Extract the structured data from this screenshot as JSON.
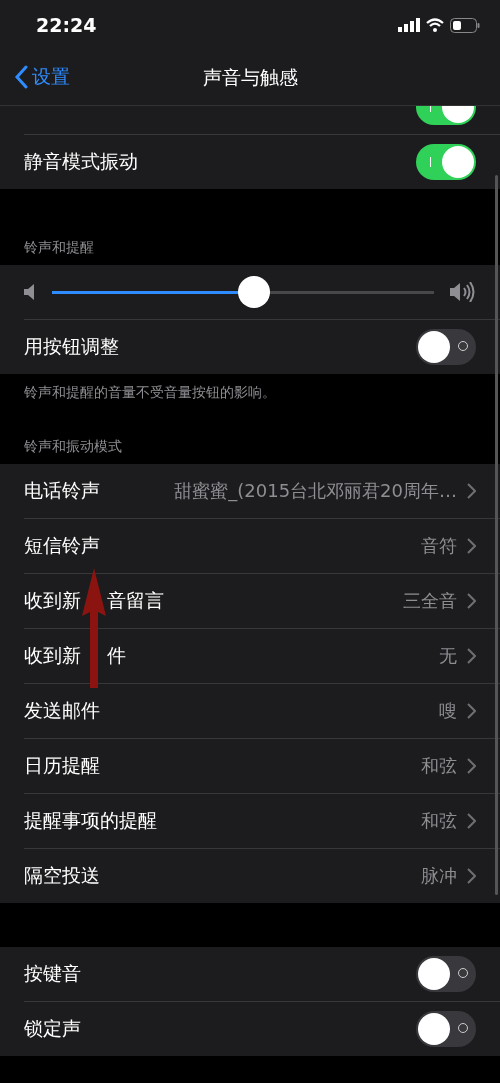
{
  "status_bar": {
    "time": "22:24"
  },
  "nav": {
    "back": "设置",
    "title": "声音与触感"
  },
  "top_rows": [
    {
      "on": true,
      "clipped": true
    },
    {
      "label": "静音模式振动",
      "on": true,
      "clipped": false
    }
  ],
  "ringer": {
    "header": "铃声和提醒",
    "level": 0.53,
    "toggle": {
      "label": "用按钮调整",
      "on": false
    },
    "footer": "铃声和提醒的音量不受音量按钮的影响。"
  },
  "patterns": {
    "header": "铃声和振动模式",
    "rows": [
      {
        "label": "电话铃声",
        "value": "甜蜜蜜_(2015台北邓丽君20周年…"
      },
      {
        "label": "短信铃声",
        "value": "音符"
      },
      {
        "label": "收到新",
        "label_after": "音留言",
        "value": "三全音"
      },
      {
        "label": "收到新",
        "label_after": "件",
        "value": "无"
      },
      {
        "label": "发送邮件",
        "value": "嗖"
      },
      {
        "label": "日历提醒",
        "value": "和弦"
      },
      {
        "label": "提醒事项的提醒",
        "value": "和弦"
      },
      {
        "label": "隔空投送",
        "value": "脉冲"
      }
    ]
  },
  "bottom_rows": [
    {
      "label": "按键音",
      "on": false
    },
    {
      "label": "锁定声",
      "on": false
    }
  ]
}
